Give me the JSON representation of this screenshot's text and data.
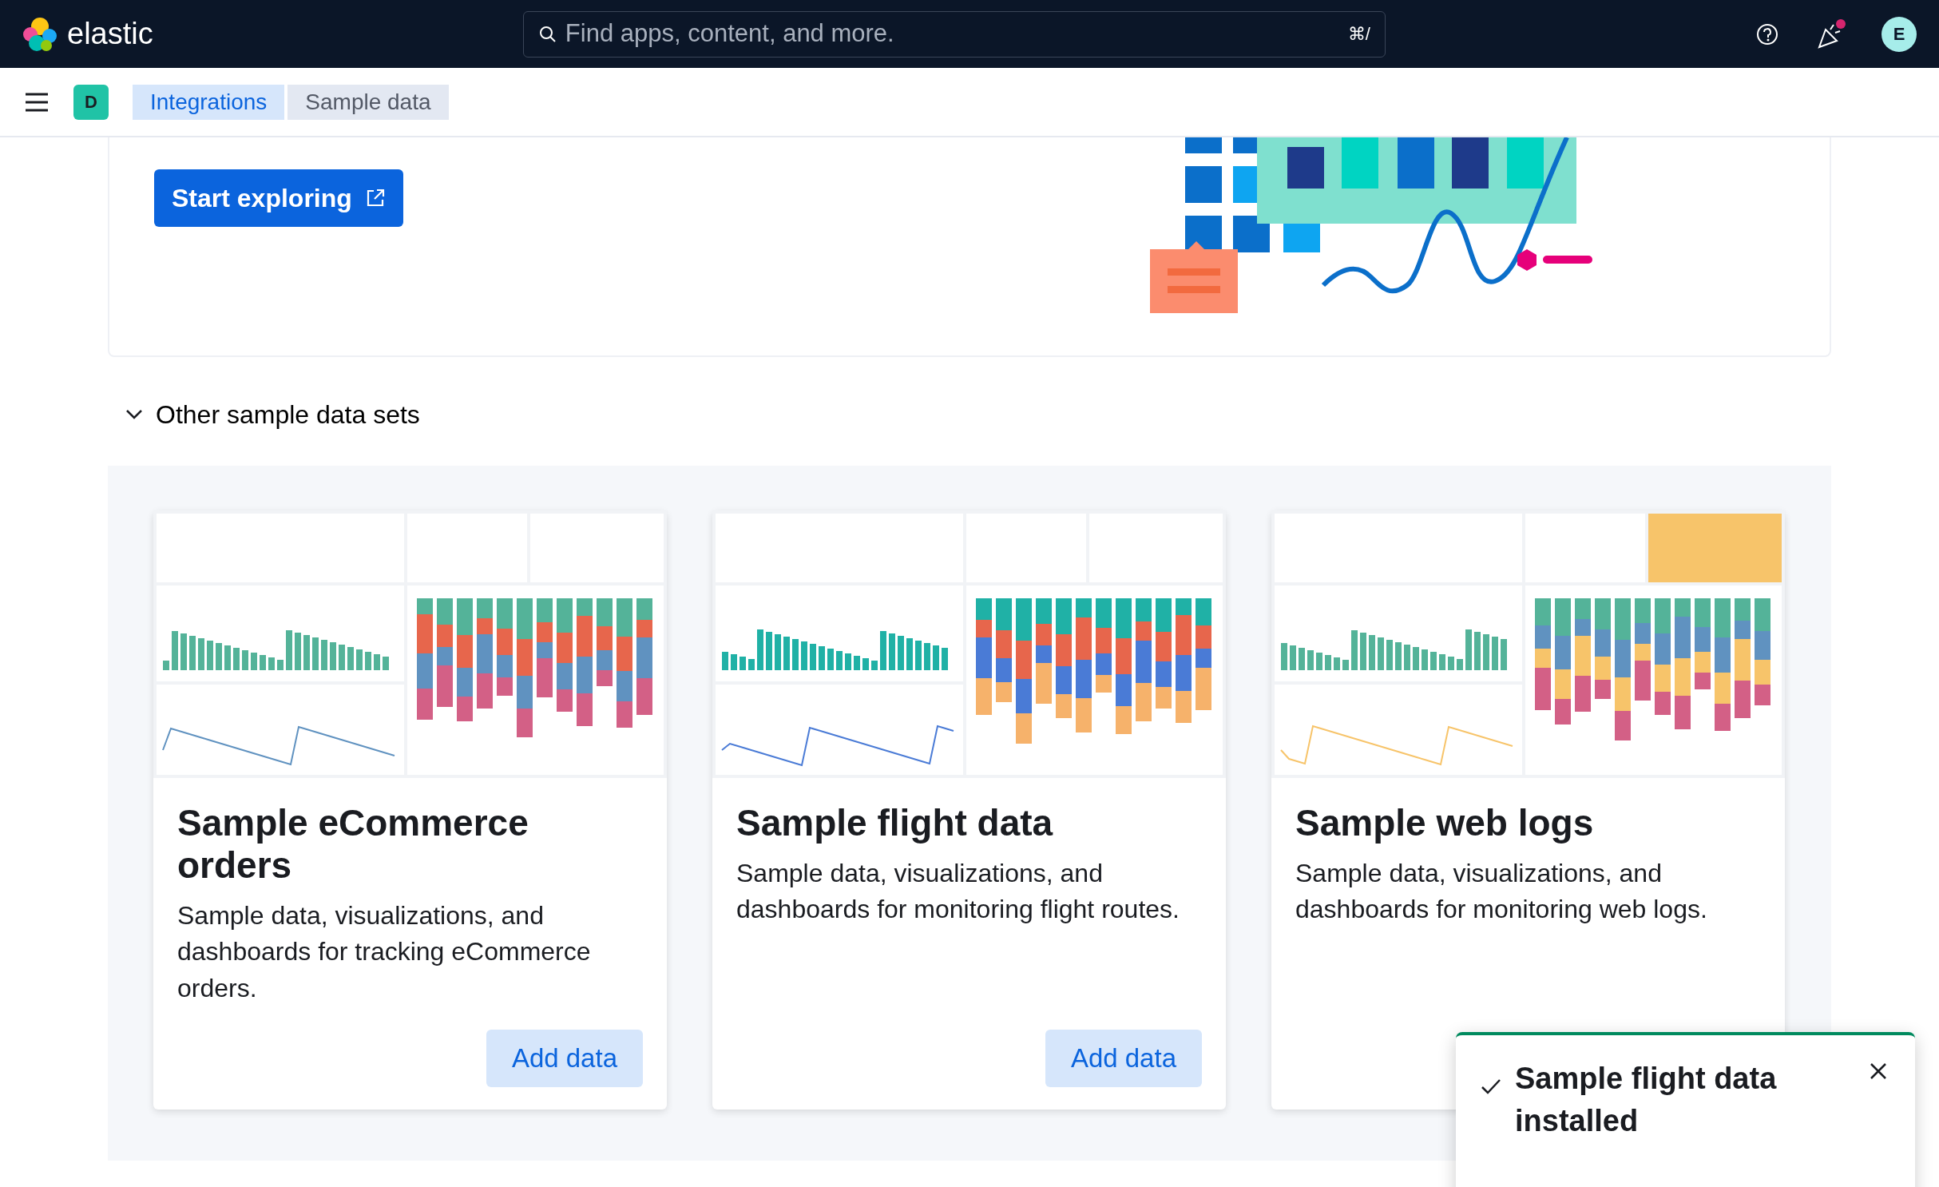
{
  "header": {
    "logo_text": "elastic",
    "search": {
      "placeholder": "Find apps, content, and more.",
      "shortcut": "⌘/"
    },
    "avatar": "E",
    "notification_dot": true
  },
  "breadcrumbs": {
    "space": "D",
    "items": [
      {
        "label": "Integrations",
        "selected": false
      },
      {
        "label": "Sample data",
        "selected": true
      }
    ]
  },
  "hero": {
    "button": "Start exploring"
  },
  "section": {
    "title": "Other sample data sets",
    "expanded": true
  },
  "cards": [
    {
      "title": "Sample eCommerce orders",
      "description": "Sample data, visualizations, and dashboards for tracking eCommerce orders.",
      "button": "Add data"
    },
    {
      "title": "Sample flight data",
      "description": "Sample data, visualizations, and dashboards for monitoring flight routes.",
      "button": "Add data"
    },
    {
      "title": "Sample web logs",
      "description": "Sample data, visualizations, and dashboards for monitoring web logs."
    }
  ],
  "toast": {
    "title": "Sample flight data installed"
  }
}
